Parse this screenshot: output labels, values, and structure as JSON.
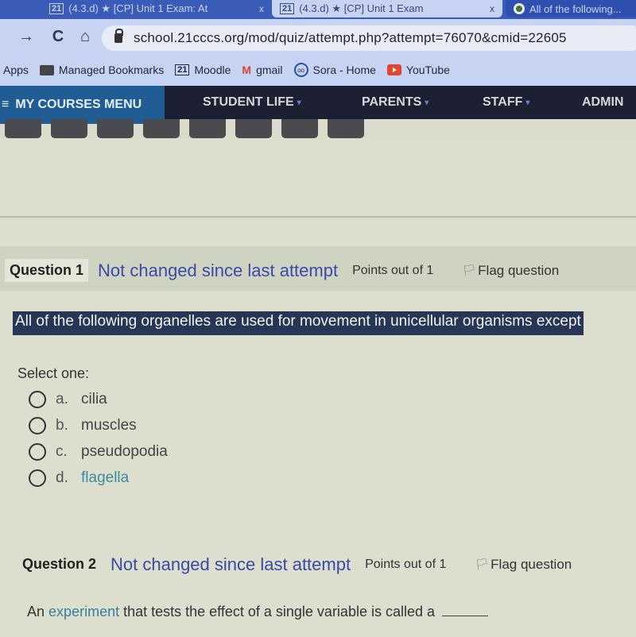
{
  "browser": {
    "tabs": [
      {
        "title": "(4.3.d) ★ [CP] Unit 1 Exam: At",
        "icon": "21cccs-icon",
        "active": false
      },
      {
        "title": "(4.3.d) ★ [CP] Unit 1 Exam",
        "icon": "21cccs-icon",
        "active": true
      },
      {
        "title": "All of the following...",
        "icon": "google-icon",
        "active": false
      }
    ],
    "close_glyph": "x",
    "nav": {
      "forward": "→",
      "reload": "C",
      "home": "⌂"
    },
    "url": "school.21cccs.org/mod/quiz/attempt.php?attempt=76070&cmid=22605",
    "bookmarks": [
      {
        "label": "Apps",
        "icon": "apps-icon"
      },
      {
        "label": "Managed Bookmarks",
        "icon": "folder-icon"
      },
      {
        "label": "Moodle",
        "icon": "21cccs-icon"
      },
      {
        "label": "gmail",
        "icon": "gmail-icon"
      },
      {
        "label": "Sora - Home",
        "icon": "sora-icon"
      },
      {
        "label": "YouTube",
        "icon": "youtube-icon"
      }
    ]
  },
  "sitenav": {
    "my_courses": "MY COURSES MENU",
    "hamburger": "≡",
    "items": [
      {
        "label": "STUDENT LIFE",
        "dropdown": true
      },
      {
        "label": "PARENTS",
        "dropdown": true
      },
      {
        "label": "STAFF",
        "dropdown": true
      },
      {
        "label": "ADMIN",
        "dropdown": false
      }
    ],
    "caret": "▾"
  },
  "questions": [
    {
      "number_label": "Question 1",
      "state": "Not changed since last attempt",
      "points": "Points out of 1",
      "flag_label": "Flag question",
      "text": "All of the following organelles are used for movement in unicellular organisms except",
      "prompt": "Select one:",
      "options": [
        {
          "letter": "a.",
          "text": "cilia",
          "link": false
        },
        {
          "letter": "b.",
          "text": "muscles",
          "link": false
        },
        {
          "letter": "c.",
          "text": "pseudopodia",
          "link": false
        },
        {
          "letter": "d.",
          "text": "flagella",
          "link": true
        }
      ]
    },
    {
      "number_label": "Question 2",
      "state": "Not changed since last attempt",
      "points": "Points out of 1",
      "flag_label": "Flag question",
      "text_pre": "An",
      "text_keyword": "experiment",
      "text_post": "that tests the effect of a single variable is called a"
    }
  ],
  "colors": {
    "state_link": "#3b4aa8",
    "glossary_link": "#3a8ca0",
    "nav_bg": "#1d1f33",
    "courses_bg": "#1f5d94"
  }
}
